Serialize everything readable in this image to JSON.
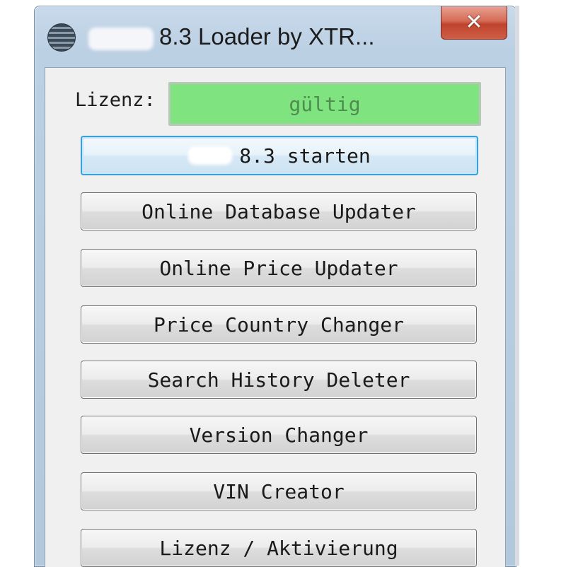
{
  "window": {
    "title": "8.3 Loader by XTR...",
    "close_symbol": "✕"
  },
  "license": {
    "label": "Lizenz:",
    "status": "gültig",
    "status_color": "#7fe37f"
  },
  "buttons": {
    "start": "8.3 starten",
    "online_db_updater": "Online Database Updater",
    "online_price_updater": "Online Price Updater",
    "price_country_changer": "Price Country Changer",
    "search_history_deleter": "Search History Deleter",
    "version_changer": "Version Changer",
    "vin_creator": "VIN Creator",
    "license_activation": "Lizenz / Aktivierung"
  },
  "colors": {
    "close_button": "#c0432c",
    "primary_border": "#3c9fd8"
  }
}
